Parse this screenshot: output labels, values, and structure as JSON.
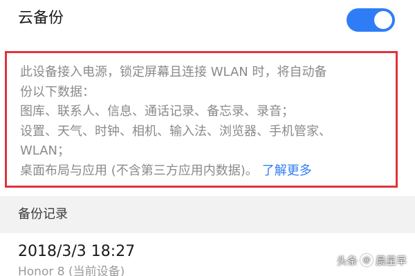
{
  "cloud_backup": {
    "label": "云备份",
    "toggle_on": true,
    "toggle_color": "#2f7df6"
  },
  "description": {
    "lines": [
      "此设备接入电源，锁定屏幕且连接 WLAN 时，将自动备",
      "份以下数据：",
      "图库、联系人、信息、通话记录、备忘录、录音；",
      "设置、天气、时钟、相机、输入法、浏览器、手机管家、",
      "WLAN；",
      "桌面布局与应用 (不含第三方应用内数据)。"
    ],
    "learn_more": "了解更多",
    "highlight_border_color": "#e0323b"
  },
  "backup_records": {
    "title": "备份记录",
    "items": [
      {
        "time": "2018/3/3 18:27",
        "device": "Honor 8 (当前设备)"
      }
    ]
  },
  "watermark": {
    "source": "头条",
    "author": "晨星早"
  }
}
